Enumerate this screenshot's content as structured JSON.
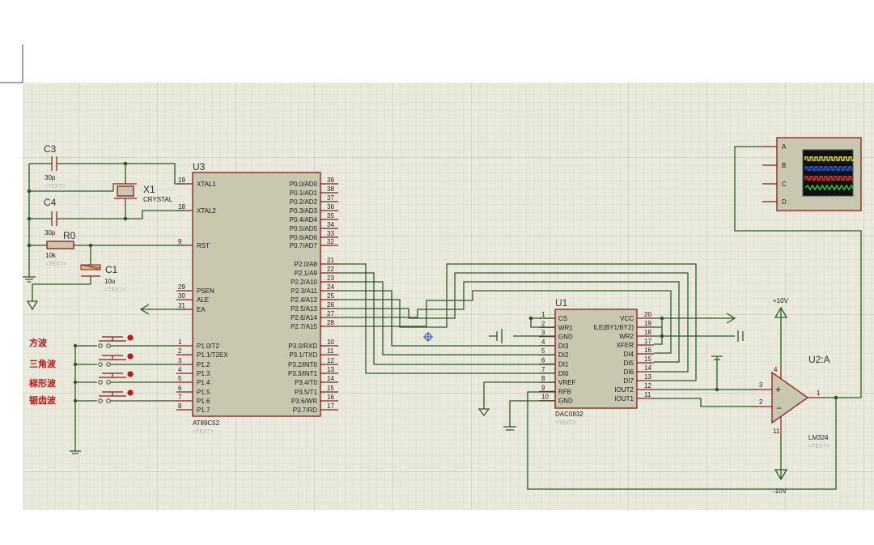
{
  "colors": {
    "wire": "#2a5a2a",
    "pin": "#8b1a1a",
    "body": "#c8c8b0",
    "sheet": "#e9e9dc",
    "label_red": "#c01818"
  },
  "u3": {
    "ref": "U3",
    "part": "AT89C52",
    "text": "<TEXT>",
    "left_pins": [
      {
        "num": "19",
        "name": "XTAL1"
      },
      {
        "num": "18",
        "name": "XTAL2"
      },
      {
        "num": "9",
        "name": "RST"
      },
      {
        "num": "29",
        "name": "PSEN"
      },
      {
        "num": "30",
        "name": "ALE"
      },
      {
        "num": "31",
        "name": "EA"
      },
      {
        "num": "1",
        "name": "P1.0/T2"
      },
      {
        "num": "2",
        "name": "P1.1/T2EX"
      },
      {
        "num": "3",
        "name": "P1.2"
      },
      {
        "num": "4",
        "name": "P1.3"
      },
      {
        "num": "5",
        "name": "P1.4"
      },
      {
        "num": "6",
        "name": "P1.5"
      },
      {
        "num": "7",
        "name": "P1.6"
      },
      {
        "num": "8",
        "name": "P1.7"
      }
    ],
    "right_pins": [
      {
        "num": "39",
        "name": "P0.0/AD0"
      },
      {
        "num": "38",
        "name": "P0.1/AD1"
      },
      {
        "num": "37",
        "name": "P0.2/AD2"
      },
      {
        "num": "36",
        "name": "P0.3/AD3"
      },
      {
        "num": "35",
        "name": "P0.4/AD4"
      },
      {
        "num": "34",
        "name": "P0.5/AD5"
      },
      {
        "num": "33",
        "name": "P0.6/AD6"
      },
      {
        "num": "32",
        "name": "P0.7/AD7"
      },
      {
        "num": "21",
        "name": "P2.0/A8"
      },
      {
        "num": "22",
        "name": "P2.1/A9"
      },
      {
        "num": "23",
        "name": "P2.2/A10"
      },
      {
        "num": "24",
        "name": "P2.3/A11"
      },
      {
        "num": "25",
        "name": "P2.4/A12"
      },
      {
        "num": "26",
        "name": "P2.5/A13"
      },
      {
        "num": "27",
        "name": "P2.6/A14"
      },
      {
        "num": "28",
        "name": "P2.7/A15"
      },
      {
        "num": "10",
        "name": "P3.0/RXD"
      },
      {
        "num": "11",
        "name": "P3.1/TXD"
      },
      {
        "num": "12",
        "name": "P3.2/INT0"
      },
      {
        "num": "13",
        "name": "P3.3/INT1"
      },
      {
        "num": "14",
        "name": "P3.4/T0"
      },
      {
        "num": "15",
        "name": "P3.5/T1"
      },
      {
        "num": "16",
        "name": "P3.6/WR"
      },
      {
        "num": "17",
        "name": "P3.7/RD"
      }
    ]
  },
  "u1": {
    "ref": "U1",
    "part": "DAC0832",
    "text": "<TEXT>",
    "left_pins": [
      {
        "num": "1",
        "name": "CS"
      },
      {
        "num": "2",
        "name": "WR1"
      },
      {
        "num": "3",
        "name": "GND"
      },
      {
        "num": "4",
        "name": "DI3"
      },
      {
        "num": "5",
        "name": "DI2"
      },
      {
        "num": "6",
        "name": "DI1"
      },
      {
        "num": "7",
        "name": "DI0"
      },
      {
        "num": "8",
        "name": "VREF"
      },
      {
        "num": "9",
        "name": "RFB"
      },
      {
        "num": "10",
        "name": "GND"
      }
    ],
    "right_pins": [
      {
        "num": "20",
        "name": "VCC"
      },
      {
        "num": "19",
        "name": "ILE(BY1/BY2)"
      },
      {
        "num": "18",
        "name": "WR2"
      },
      {
        "num": "17",
        "name": "XFER"
      },
      {
        "num": "16",
        "name": "DI4"
      },
      {
        "num": "15",
        "name": "DI5"
      },
      {
        "num": "14",
        "name": "DI6"
      },
      {
        "num": "13",
        "name": "DI7"
      },
      {
        "num": "12",
        "name": "IOUT2"
      },
      {
        "num": "11",
        "name": "IOUT1"
      }
    ]
  },
  "u2": {
    "ref": "U2:A",
    "part": "LM324",
    "text": "<TEXT>",
    "pin_plus": "3",
    "pin_minus": "2",
    "pin_out": "1",
    "pin_v4": "4",
    "pin_v11": "11",
    "vpos": "+10V",
    "vneg": "-10V"
  },
  "c3": {
    "ref": "C3",
    "value": "30p",
    "text": "<TEXT>"
  },
  "c4": {
    "ref": "C4",
    "value": "30p",
    "text": "<TEXT>"
  },
  "x1": {
    "ref": "X1",
    "value": "CRYSTAL"
  },
  "r0": {
    "ref": "R0",
    "value": "10k",
    "text": "<TEXT>"
  },
  "c1": {
    "ref": "C1",
    "value": "10u",
    "text": "<TEXT>"
  },
  "scope": {
    "channels": [
      "A",
      "B",
      "C",
      "D"
    ],
    "trace_colors": [
      "#e8e800",
      "#2060ff",
      "#ff3030",
      "#30d030"
    ]
  },
  "buttons": [
    "方波",
    "三角波",
    "梯形波",
    "锯齿波"
  ]
}
